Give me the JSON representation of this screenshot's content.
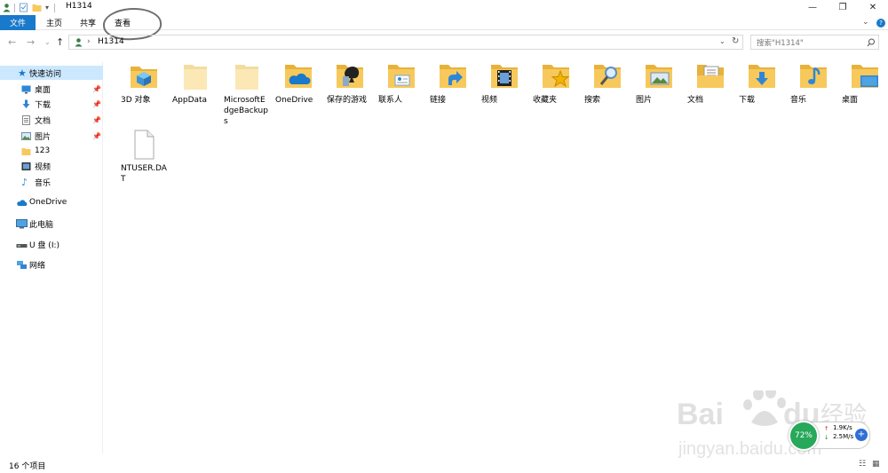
{
  "window": {
    "title": "H1314",
    "minimize": "—",
    "restore": "❐",
    "close": "✕"
  },
  "ribbon": {
    "tabs": [
      "文件",
      "主页",
      "共享",
      "查看"
    ],
    "expand": "⌄",
    "help": "?"
  },
  "addressbar": {
    "path": "H1314",
    "separator": "›",
    "search_placeholder": "搜索\"H1314\""
  },
  "sidebar": {
    "items": [
      {
        "label": "快速访问",
        "icon": "star-icon",
        "pinned": false
      },
      {
        "label": "桌面",
        "icon": "desktop-icon",
        "pinned": true
      },
      {
        "label": "下载",
        "icon": "download-icon",
        "pinned": true
      },
      {
        "label": "文档",
        "icon": "document-icon",
        "pinned": true
      },
      {
        "label": "图片",
        "icon": "picture-icon",
        "pinned": true
      },
      {
        "label": "123",
        "icon": "folder-icon",
        "pinned": false
      },
      {
        "label": "视频",
        "icon": "video-icon",
        "pinned": false
      },
      {
        "label": "音乐",
        "icon": "music-icon",
        "pinned": false
      },
      {
        "label": "OneDrive",
        "icon": "cloud-icon",
        "pinned": false
      },
      {
        "label": "此电脑",
        "icon": "computer-icon",
        "pinned": false
      },
      {
        "label": "U 盘 (I:)",
        "icon": "usb-drive-icon",
        "pinned": false
      },
      {
        "label": "网络",
        "icon": "network-icon",
        "pinned": false
      }
    ]
  },
  "files": [
    {
      "name": "3D 对象",
      "icon": "3d-objects-folder-icon"
    },
    {
      "name": "AppData",
      "icon": "folder-icon"
    },
    {
      "name": "MicrosoftEdgeBackups",
      "icon": "folder-icon"
    },
    {
      "name": "OneDrive",
      "icon": "onedrive-folder-icon"
    },
    {
      "name": "保存的游戏",
      "icon": "saved-games-folder-icon"
    },
    {
      "name": "联系人",
      "icon": "contacts-folder-icon"
    },
    {
      "name": "链接",
      "icon": "links-folder-icon"
    },
    {
      "name": "视频",
      "icon": "videos-folder-icon"
    },
    {
      "name": "收藏夹",
      "icon": "favorites-folder-icon"
    },
    {
      "name": "搜索",
      "icon": "searches-folder-icon"
    },
    {
      "name": "图片",
      "icon": "pictures-folder-icon"
    },
    {
      "name": "文档",
      "icon": "documents-folder-icon"
    },
    {
      "name": "下载",
      "icon": "downloads-folder-icon"
    },
    {
      "name": "音乐",
      "icon": "music-folder-icon"
    },
    {
      "name": "桌面",
      "icon": "desktop-folder-icon"
    },
    {
      "name": "NTUSER.DAT",
      "icon": "file-icon"
    }
  ],
  "status": {
    "count": "16 个项目"
  },
  "widget": {
    "percent": "72%",
    "up": "1.9K/s",
    "down": "2.5M/s"
  },
  "watermark": {
    "brand": "Baidu经验",
    "url": "jingyan.baidu.com"
  },
  "colors": {
    "accent": "#1979ca",
    "folder": "#f7c95c",
    "folder_dark": "#e8b23a",
    "selected": "#cce8ff"
  }
}
